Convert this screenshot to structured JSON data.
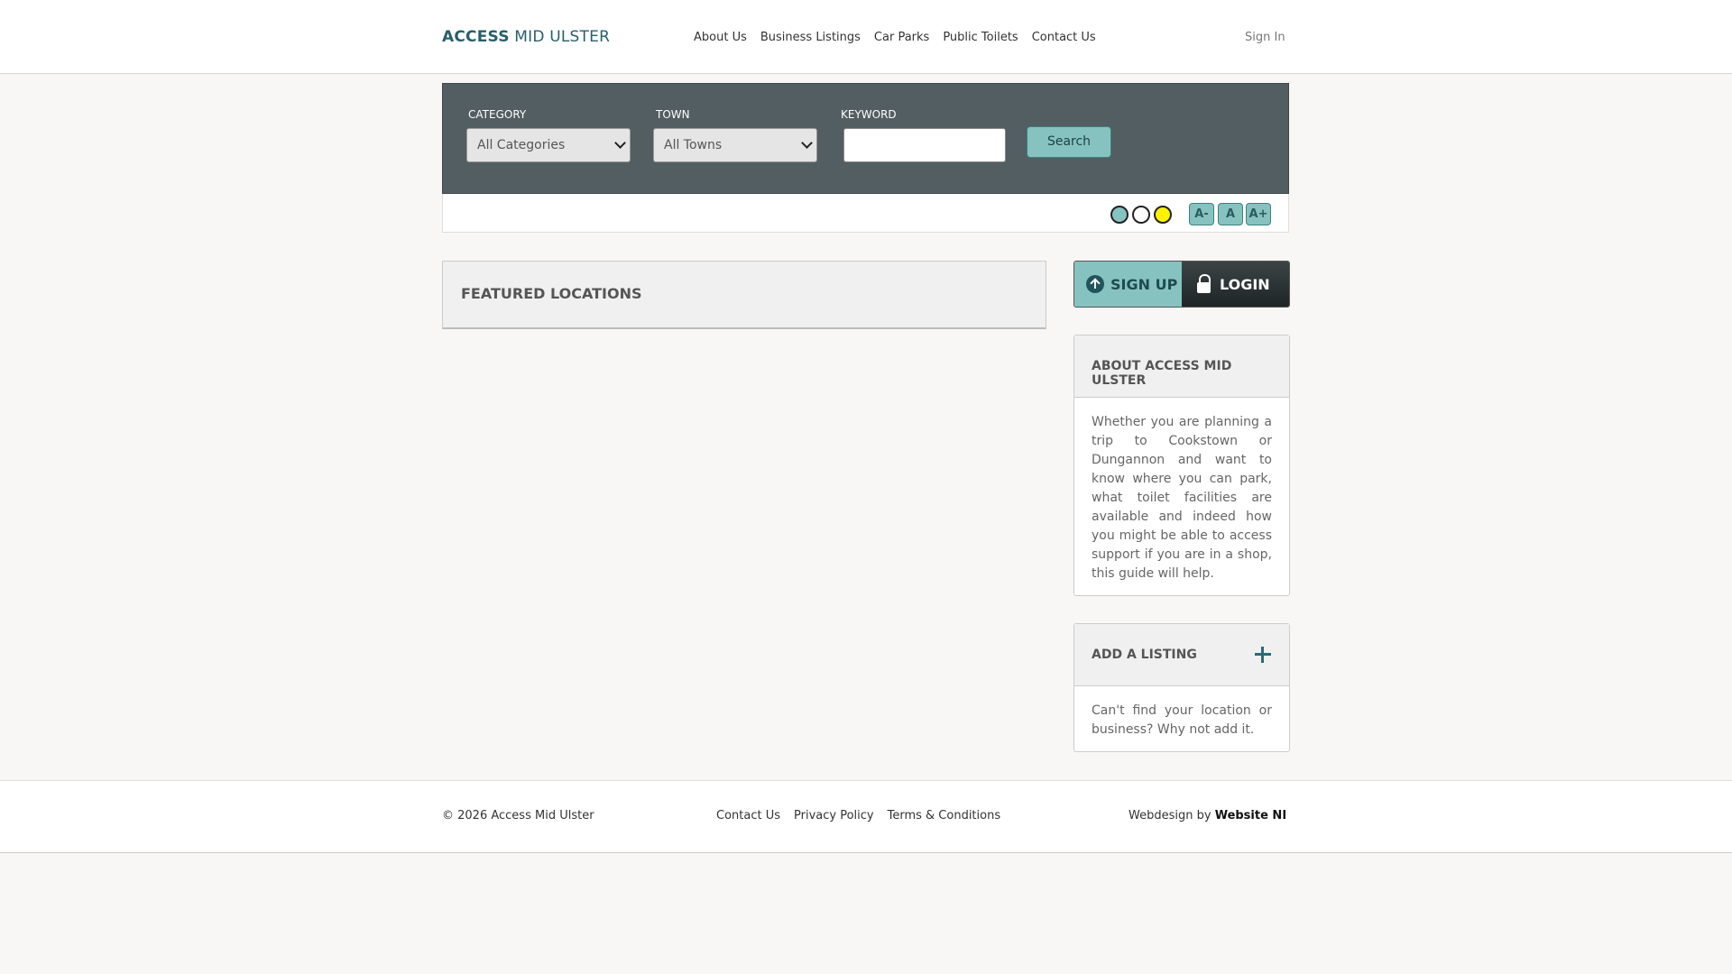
{
  "header": {
    "logo_bold": "ACCESS",
    "logo_rest": "MID ULSTER",
    "nav": [
      "About Us",
      "Business Listings",
      "Car Parks",
      "Public Toilets",
      "Contact Us"
    ],
    "sign_in": "Sign In"
  },
  "search": {
    "category_label": "CATEGORY",
    "category_value": "All Categories",
    "town_label": "TOWN",
    "town_value": "All Towns",
    "keyword_label": "KEYWORD",
    "keyword_value": "",
    "button": "Search"
  },
  "accessibility": {
    "contrast_colors": [
      "#86c3c0",
      "#ffffff",
      "#fff200"
    ],
    "font_buttons": [
      "A-",
      "A",
      "A+"
    ]
  },
  "featured": {
    "title": "FEATURED LOCATIONS"
  },
  "auth": {
    "signup": "SIGN UP",
    "login": "LOGIN"
  },
  "about": {
    "title": "ABOUT ACCESS MID ULSTER",
    "text": "Whether you are planning a trip to Cookstown or Dungannon and want to know where you can park, what toilet facilities are available and indeed how you might be able to access support if you are in a shop, this guide will help."
  },
  "add_listing": {
    "title": "ADD A LISTING",
    "text": "Can't find your location or business? Why not add it."
  },
  "footer": {
    "copyright": "© 2026 Access Mid Ulster",
    "links": [
      "Contact Us",
      "Privacy Policy",
      "Terms & Conditions"
    ],
    "credit_prefix": "Webdesign by",
    "credit_name": "Website NI"
  },
  "colors": {
    "brand": "#27606a",
    "accent": "#86c3c0",
    "panel": "#535e62"
  }
}
